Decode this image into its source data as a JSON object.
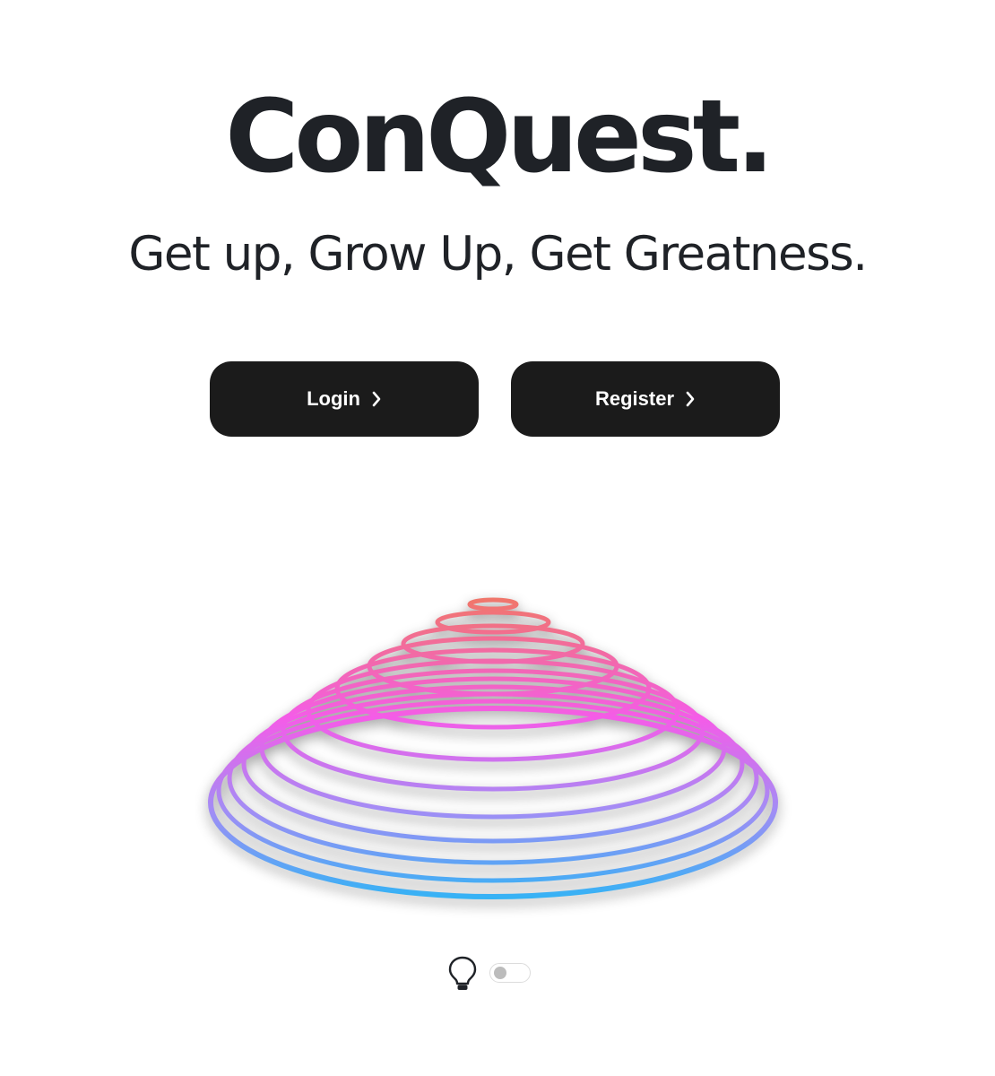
{
  "brand": {
    "title": "ConQuest."
  },
  "hero": {
    "tagline": "Get up, Grow Up, Get Greatness."
  },
  "actions": {
    "login_label": "Login",
    "register_label": "Register",
    "button_icon": "chevron-right-icon"
  },
  "theme_switch": {
    "icon": "lightbulb-icon",
    "enabled": false
  },
  "colors": {
    "text": "#1f2227",
    "button_bg": "#1b1b1b",
    "button_text": "#ffffff",
    "ring_top": "#f07a5a",
    "ring_middle": "#f45ce8",
    "ring_bottom": "#2bb6f5"
  }
}
